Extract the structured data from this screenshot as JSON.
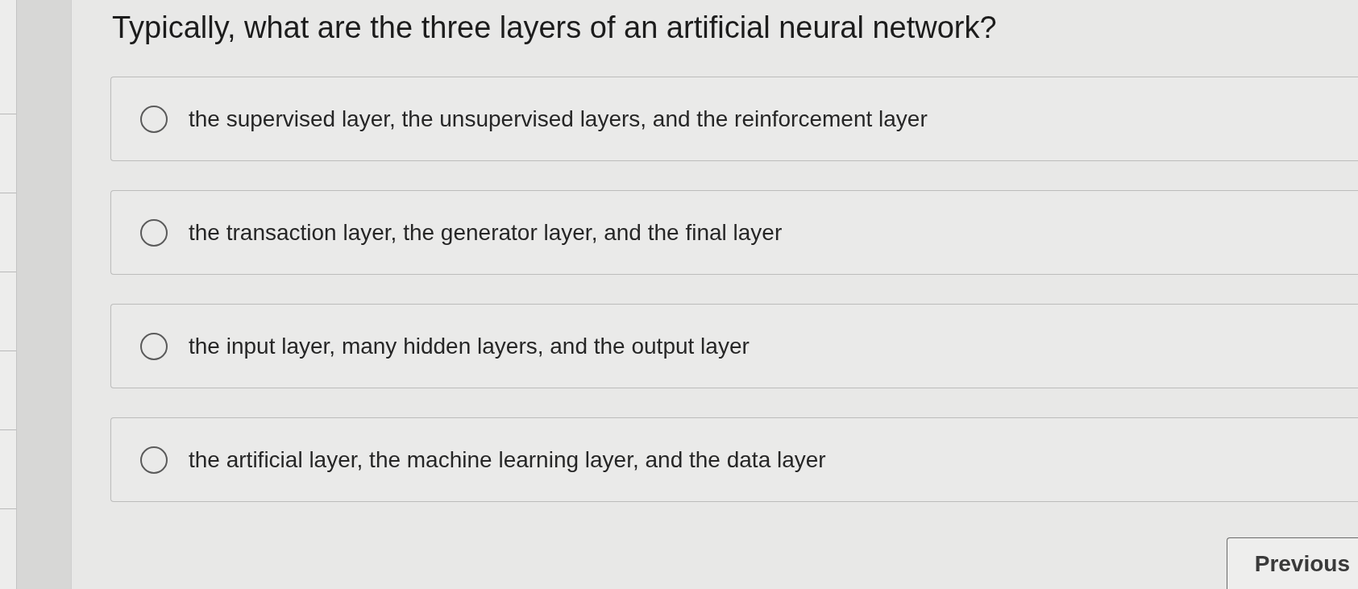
{
  "question": {
    "text": "Typically, what are the three layers of an artificial neural network?"
  },
  "options": [
    {
      "label": "the supervised layer, the unsupervised layers, and the reinforcement layer",
      "selected": false
    },
    {
      "label": "the transaction layer, the generator layer, and the final layer",
      "selected": false
    },
    {
      "label": "the input layer, many hidden layers, and the output layer",
      "selected": false
    },
    {
      "label": "the artificial layer, the machine learning layer, and the data layer",
      "selected": false
    }
  ],
  "buttons": [
    {
      "label": "Previous"
    }
  ]
}
